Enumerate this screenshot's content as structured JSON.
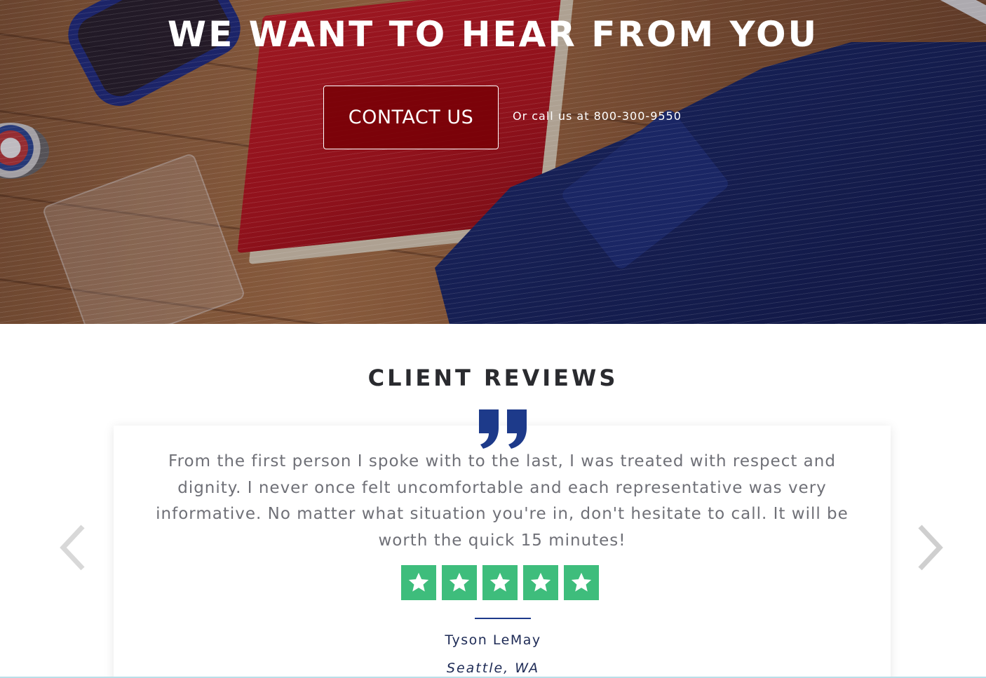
{
  "hero": {
    "title": "WE WANT TO HEAR FROM YOU",
    "contact_button_label": "CONTACT US",
    "call_text": "Or call us at 800-300-9550"
  },
  "reviews": {
    "section_title": "CLIENT REVIEWS",
    "current_review": {
      "text": "From the first person I spoke with to the last, I was treated with respect and dignity. I never once felt uncomfortable and each representative was very informative. No matter what situation you're in, don't hesitate to call. It will be worth the quick 15 minutes!",
      "rating": 5,
      "max_rating": 5,
      "reviewer_name": "Tyson LeMay",
      "reviewer_location": "Seattle, WA"
    },
    "nav": {
      "prev_icon": "chevron-left-icon",
      "next_icon": "chevron-right-icon"
    }
  },
  "colors": {
    "button_bg": "#780006",
    "star_green": "#3ebd7c",
    "quote_navy": "#1d3a8a",
    "heading_dark": "#2a2b2f",
    "review_text_gray": "#6f7077"
  }
}
